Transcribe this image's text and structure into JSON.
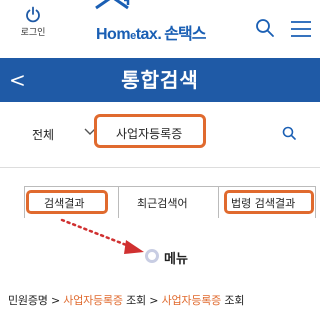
{
  "header": {
    "login_label": "로그인",
    "logo_en_1": "Hom",
    "logo_en_2": "e",
    "logo_en_3": "tax.",
    "logo_ko": "손택스",
    "brand_color": "#1a5fb4"
  },
  "titlebar": {
    "title": "통합검색",
    "back_glyph": "<",
    "color": "#1f5aa6"
  },
  "search": {
    "scope_value": "전체",
    "query_value": "사업자등록증"
  },
  "tabs": [
    {
      "label": "검색결과"
    },
    {
      "label": "최근검색어"
    },
    {
      "label": "법령 검색결과"
    }
  ],
  "menu": {
    "label": "메뉴"
  },
  "breadcrumb": {
    "part1": "민원증명 > ",
    "part2": "사업자등록증",
    "part3": " 조회 > ",
    "part4": "사업자등록증",
    "part5": " 조회"
  },
  "highlight_color": "#e06a2e"
}
